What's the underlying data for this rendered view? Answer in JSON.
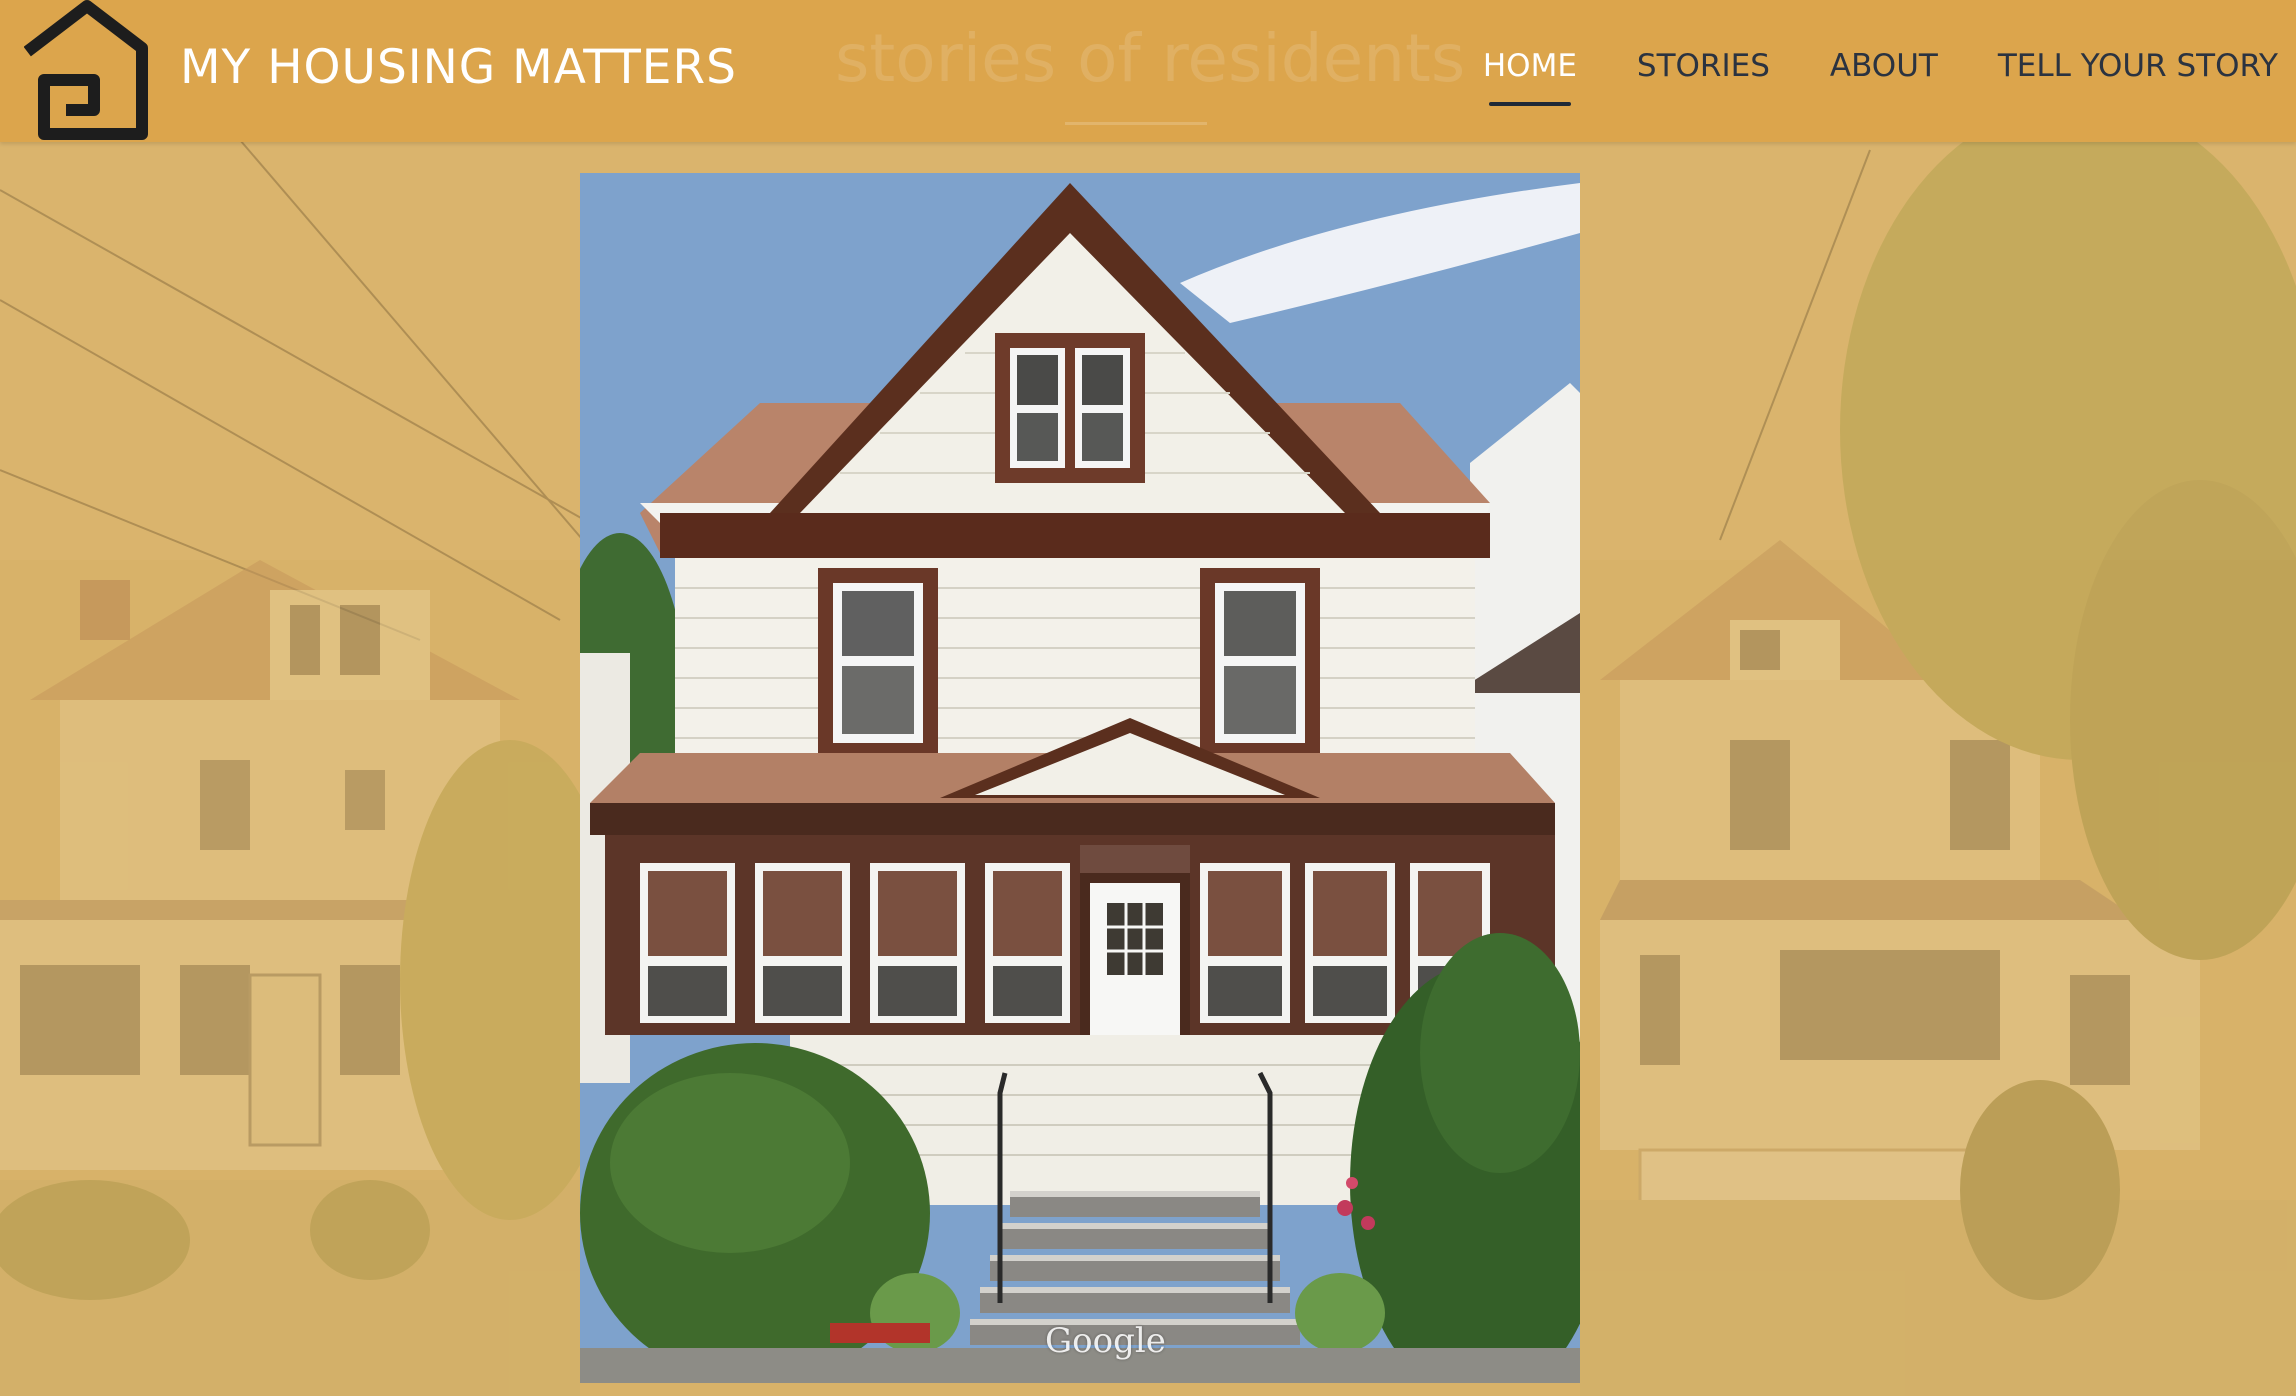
{
  "site": {
    "title": "MY HOUSING MATTERS",
    "tagline": "stories of residents"
  },
  "nav": {
    "items": [
      {
        "label": "HOME",
        "active": true
      },
      {
        "label": "STORIES",
        "active": false
      },
      {
        "label": "ABOUT",
        "active": false
      },
      {
        "label": "TELL YOUR STORY",
        "active": false
      }
    ]
  },
  "photo": {
    "watermark": "Google"
  },
  "colors": {
    "header": "#dca54c",
    "overlay": "#d9b266",
    "nav_text": "#2b3340",
    "active_underline": "#1f2937"
  },
  "icons": {
    "logo": "house-logo-icon"
  }
}
